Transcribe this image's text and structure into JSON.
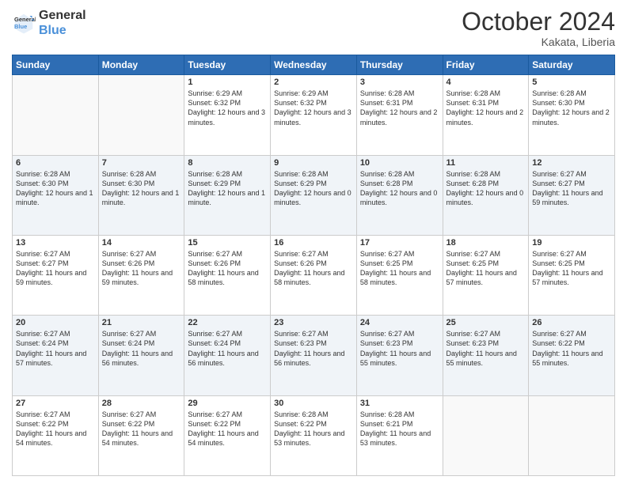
{
  "logo": {
    "line1": "General",
    "line2": "Blue"
  },
  "title": "October 2024",
  "location": "Kakata, Liberia",
  "weekdays": [
    "Sunday",
    "Monday",
    "Tuesday",
    "Wednesday",
    "Thursday",
    "Friday",
    "Saturday"
  ],
  "weeks": [
    [
      {
        "day": "",
        "info": ""
      },
      {
        "day": "",
        "info": ""
      },
      {
        "day": "1",
        "info": "Sunrise: 6:29 AM\nSunset: 6:32 PM\nDaylight: 12 hours and 3 minutes."
      },
      {
        "day": "2",
        "info": "Sunrise: 6:29 AM\nSunset: 6:32 PM\nDaylight: 12 hours and 3 minutes."
      },
      {
        "day": "3",
        "info": "Sunrise: 6:28 AM\nSunset: 6:31 PM\nDaylight: 12 hours and 2 minutes."
      },
      {
        "day": "4",
        "info": "Sunrise: 6:28 AM\nSunset: 6:31 PM\nDaylight: 12 hours and 2 minutes."
      },
      {
        "day": "5",
        "info": "Sunrise: 6:28 AM\nSunset: 6:30 PM\nDaylight: 12 hours and 2 minutes."
      }
    ],
    [
      {
        "day": "6",
        "info": "Sunrise: 6:28 AM\nSunset: 6:30 PM\nDaylight: 12 hours and 1 minute."
      },
      {
        "day": "7",
        "info": "Sunrise: 6:28 AM\nSunset: 6:30 PM\nDaylight: 12 hours and 1 minute."
      },
      {
        "day": "8",
        "info": "Sunrise: 6:28 AM\nSunset: 6:29 PM\nDaylight: 12 hours and 1 minute."
      },
      {
        "day": "9",
        "info": "Sunrise: 6:28 AM\nSunset: 6:29 PM\nDaylight: 12 hours and 0 minutes."
      },
      {
        "day": "10",
        "info": "Sunrise: 6:28 AM\nSunset: 6:28 PM\nDaylight: 12 hours and 0 minutes."
      },
      {
        "day": "11",
        "info": "Sunrise: 6:28 AM\nSunset: 6:28 PM\nDaylight: 12 hours and 0 minutes."
      },
      {
        "day": "12",
        "info": "Sunrise: 6:27 AM\nSunset: 6:27 PM\nDaylight: 11 hours and 59 minutes."
      }
    ],
    [
      {
        "day": "13",
        "info": "Sunrise: 6:27 AM\nSunset: 6:27 PM\nDaylight: 11 hours and 59 minutes."
      },
      {
        "day": "14",
        "info": "Sunrise: 6:27 AM\nSunset: 6:26 PM\nDaylight: 11 hours and 59 minutes."
      },
      {
        "day": "15",
        "info": "Sunrise: 6:27 AM\nSunset: 6:26 PM\nDaylight: 11 hours and 58 minutes."
      },
      {
        "day": "16",
        "info": "Sunrise: 6:27 AM\nSunset: 6:26 PM\nDaylight: 11 hours and 58 minutes."
      },
      {
        "day": "17",
        "info": "Sunrise: 6:27 AM\nSunset: 6:25 PM\nDaylight: 11 hours and 58 minutes."
      },
      {
        "day": "18",
        "info": "Sunrise: 6:27 AM\nSunset: 6:25 PM\nDaylight: 11 hours and 57 minutes."
      },
      {
        "day": "19",
        "info": "Sunrise: 6:27 AM\nSunset: 6:25 PM\nDaylight: 11 hours and 57 minutes."
      }
    ],
    [
      {
        "day": "20",
        "info": "Sunrise: 6:27 AM\nSunset: 6:24 PM\nDaylight: 11 hours and 57 minutes."
      },
      {
        "day": "21",
        "info": "Sunrise: 6:27 AM\nSunset: 6:24 PM\nDaylight: 11 hours and 56 minutes."
      },
      {
        "day": "22",
        "info": "Sunrise: 6:27 AM\nSunset: 6:24 PM\nDaylight: 11 hours and 56 minutes."
      },
      {
        "day": "23",
        "info": "Sunrise: 6:27 AM\nSunset: 6:23 PM\nDaylight: 11 hours and 56 minutes."
      },
      {
        "day": "24",
        "info": "Sunrise: 6:27 AM\nSunset: 6:23 PM\nDaylight: 11 hours and 55 minutes."
      },
      {
        "day": "25",
        "info": "Sunrise: 6:27 AM\nSunset: 6:23 PM\nDaylight: 11 hours and 55 minutes."
      },
      {
        "day": "26",
        "info": "Sunrise: 6:27 AM\nSunset: 6:22 PM\nDaylight: 11 hours and 55 minutes."
      }
    ],
    [
      {
        "day": "27",
        "info": "Sunrise: 6:27 AM\nSunset: 6:22 PM\nDaylight: 11 hours and 54 minutes."
      },
      {
        "day": "28",
        "info": "Sunrise: 6:27 AM\nSunset: 6:22 PM\nDaylight: 11 hours and 54 minutes."
      },
      {
        "day": "29",
        "info": "Sunrise: 6:27 AM\nSunset: 6:22 PM\nDaylight: 11 hours and 54 minutes."
      },
      {
        "day": "30",
        "info": "Sunrise: 6:28 AM\nSunset: 6:22 PM\nDaylight: 11 hours and 53 minutes."
      },
      {
        "day": "31",
        "info": "Sunrise: 6:28 AM\nSunset: 6:21 PM\nDaylight: 11 hours and 53 minutes."
      },
      {
        "day": "",
        "info": ""
      },
      {
        "day": "",
        "info": ""
      }
    ]
  ]
}
